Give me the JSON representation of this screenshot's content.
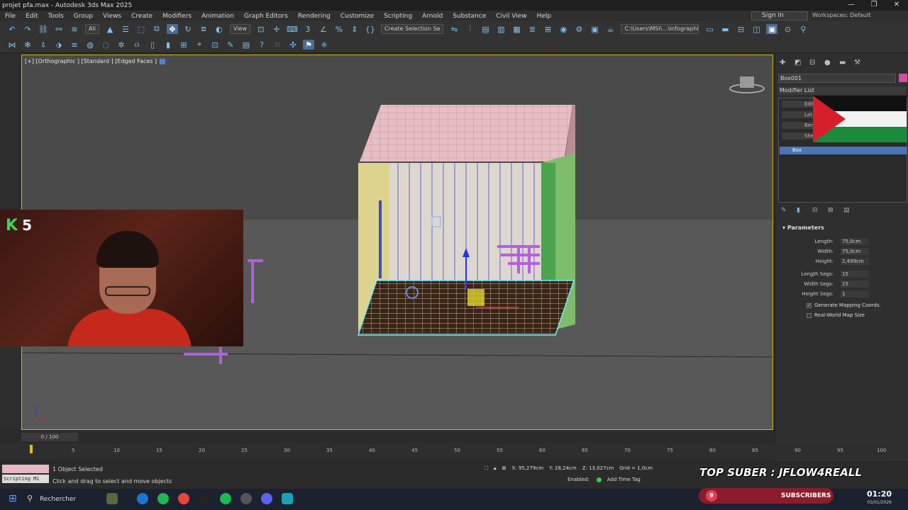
{
  "window": {
    "title": "projet pfa.max - Autodesk 3ds Max 2025",
    "controls": [
      "—",
      "❐",
      "✕"
    ]
  },
  "menu": [
    "File",
    "Edit",
    "Tools",
    "Group",
    "Views",
    "Create",
    "Modifiers",
    "Animation",
    "Graph Editors",
    "Rendering",
    "Customize",
    "Scripting",
    "Arnold",
    "Substance",
    "Civil View",
    "Help"
  ],
  "account": {
    "sign_in": "Sign In",
    "workspaces": "Workspaces: Default"
  },
  "toolbar": {
    "filter": "All",
    "ref_coord": "View",
    "selection_set": "Create Selection Se",
    "project_path": "C:\\Users\\MSI\\...\\infographiste"
  },
  "viewport": {
    "label": "[+] [Orthographic ] [Standard ] [Edged Faces ]"
  },
  "webcam": {
    "badge_letter": "K",
    "badge_count": "5"
  },
  "command_panel": {
    "object_name": "Box001",
    "object_color": "#d24ea0",
    "modifier_list": "Modifier List",
    "stack_partial": [
      "Edit",
      "Lat",
      "Ben",
      "She"
    ],
    "stack_selected": "Box",
    "parameters_title": "Parameters",
    "params": [
      {
        "label": "Length:",
        "value": "75,0cm"
      },
      {
        "label": "Width:",
        "value": "75,0cm"
      },
      {
        "label": "Height:",
        "value": "2,499cm"
      },
      {
        "label": "Length Segs:",
        "value": "15"
      },
      {
        "label": "Width Segs:",
        "value": "15"
      },
      {
        "label": "Height Segs:",
        "value": "1"
      }
    ],
    "checkboxes": [
      {
        "label": "Generate Mapping Coords.",
        "checked": "✓"
      },
      {
        "label": "Real-World Map Size",
        "checked": ""
      }
    ]
  },
  "timeline": {
    "slider": "0 / 100",
    "ticks": [
      "5",
      "10",
      "15",
      "20",
      "25",
      "30",
      "35",
      "40",
      "45",
      "50",
      "55",
      "60",
      "65",
      "70",
      "75",
      "80",
      "85",
      "90",
      "95",
      "100"
    ]
  },
  "status": {
    "script_label": "Scripting Mi",
    "selection": "1 Object Selected",
    "prompt": "Click and drag to select and move objects",
    "x": "X: 95,279cm",
    "y": "Y: 28,24cm",
    "z": "Z: 13,027cm",
    "grid": "Grid = 1,0cm",
    "enabled": "Enabled:",
    "add_time_tag": "Add Time Tag"
  },
  "overlay": {
    "top_suber": "TOP SUBER : JFLOW4REALL",
    "subscribers": "SUBSCRIBERS",
    "sub_count": "9"
  },
  "taskbar": {
    "search": "Rechercher",
    "time": "01:20",
    "date": "03/01/2026"
  }
}
